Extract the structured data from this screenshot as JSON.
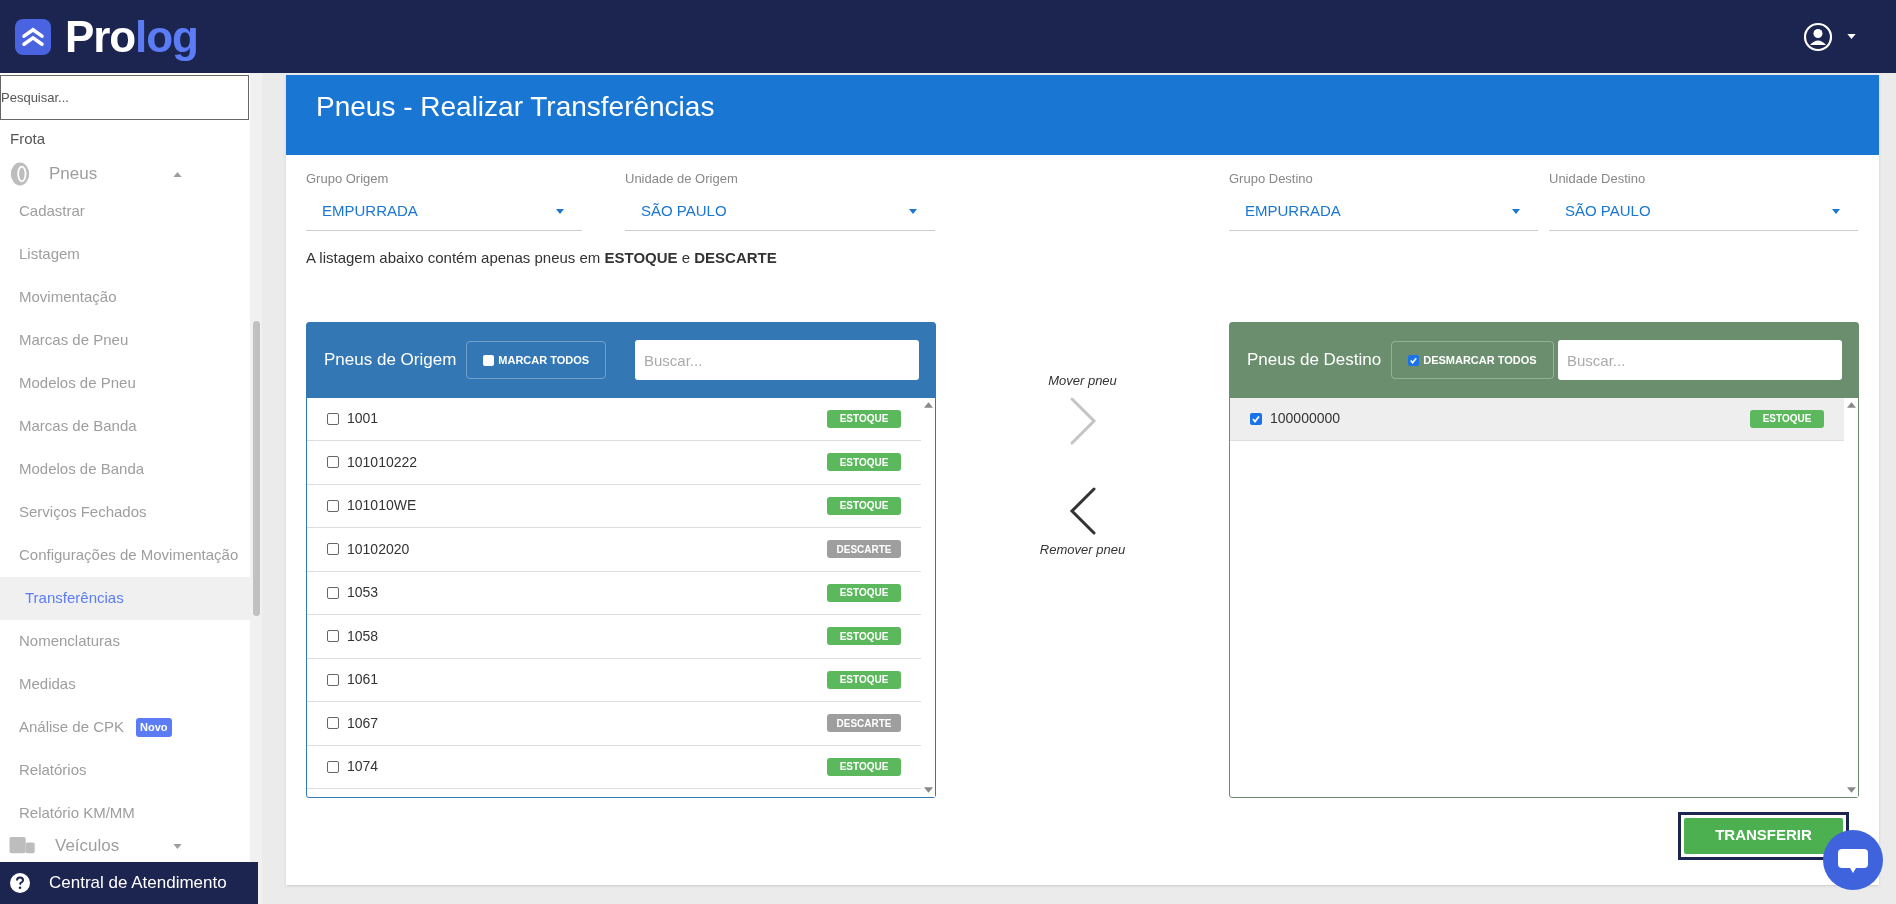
{
  "header": {
    "logo_text": "Pro",
    "logo_accent": "log"
  },
  "sidebar": {
    "search": {
      "placeholder": "Pesquisar..."
    },
    "items": [
      {
        "kind": "section",
        "label": "Frota"
      },
      {
        "kind": "group",
        "label": "Pneus",
        "expanded": true,
        "children": [
          {
            "label": "Cadastrar",
            "selected": false
          },
          {
            "label": "Listagem",
            "selected": false
          },
          {
            "label": "Movimentação",
            "selected": false
          },
          {
            "label": "Marcas de Pneu",
            "selected": false
          },
          {
            "label": "Modelos de Pneu",
            "selected": false
          },
          {
            "label": "Marcas de Banda",
            "selected": false
          },
          {
            "label": "Modelos de Banda",
            "selected": false
          },
          {
            "label": "Serviços Fechados",
            "selected": false
          },
          {
            "label": "Configurações de Movimentação",
            "selected": false
          },
          {
            "label": "Transferências",
            "selected": true
          },
          {
            "label": "Nomenclaturas",
            "selected": false
          },
          {
            "label": "Medidas",
            "selected": false
          },
          {
            "label": "Análise de CPK",
            "selected": false,
            "badge": "Novo"
          },
          {
            "label": "Relatórios",
            "selected": false
          },
          {
            "label": "Relatório KM/MM",
            "selected": false
          }
        ]
      },
      {
        "kind": "group",
        "label": "Veículos",
        "expanded": false
      }
    ],
    "help": "Central de Atendimento"
  },
  "page": {
    "title": "Pneus - Realizar Transferências",
    "filters": [
      {
        "label": "Grupo Origem",
        "value": "EMPURRADA"
      },
      {
        "label": "Unidade de Origem",
        "value": "SÃO PAULO"
      },
      {
        "label": "Grupo Destino",
        "value": "EMPURRADA"
      },
      {
        "label": "Unidade Destino",
        "value": "SÃO PAULO"
      }
    ],
    "note": "A listagem abaixo contém apenas pneus em **ESTOQUE** e **DESCARTE**",
    "origin": {
      "title": "Pneus de Origem",
      "toggle": {
        "label": "MARCAR TODOS",
        "checked": false
      },
      "search": {
        "placeholder": "Buscar..."
      },
      "rows": [
        {
          "code": "1001",
          "checked": false,
          "status": "ESTOQUE",
          "color": "#5cb85c"
        },
        {
          "code": "101010222",
          "checked": false,
          "status": "ESTOQUE",
          "color": "#5cb85c"
        },
        {
          "code": "101010WE",
          "checked": false,
          "status": "ESTOQUE",
          "color": "#5cb85c"
        },
        {
          "code": "10102020",
          "checked": false,
          "status": "DESCARTE",
          "color": "#9e9e9e"
        },
        {
          "code": "1053",
          "checked": false,
          "status": "ESTOQUE",
          "color": "#5cb85c"
        },
        {
          "code": "1058",
          "checked": false,
          "status": "ESTOQUE",
          "color": "#5cb85c"
        },
        {
          "code": "1061",
          "checked": false,
          "status": "ESTOQUE",
          "color": "#5cb85c"
        },
        {
          "code": "1067",
          "checked": false,
          "status": "DESCARTE",
          "color": "#9e9e9e"
        },
        {
          "code": "1074",
          "checked": false,
          "status": "ESTOQUE",
          "color": "#5cb85c"
        }
      ]
    },
    "move": {
      "label": "Mover pneu",
      "disabled": true
    },
    "remove": {
      "label": "Remover pneu",
      "disabled": false
    },
    "destination": {
      "title": "Pneus de Destino",
      "toggle": {
        "label": "DESMARCAR TODOS",
        "checked": true
      },
      "search": {
        "placeholder": "Buscar..."
      },
      "rows": [
        {
          "code": "100000000",
          "checked": true,
          "status": "ESTOQUE",
          "color": "#5cb85c"
        }
      ]
    },
    "submit": "TRANSFERIR"
  }
}
